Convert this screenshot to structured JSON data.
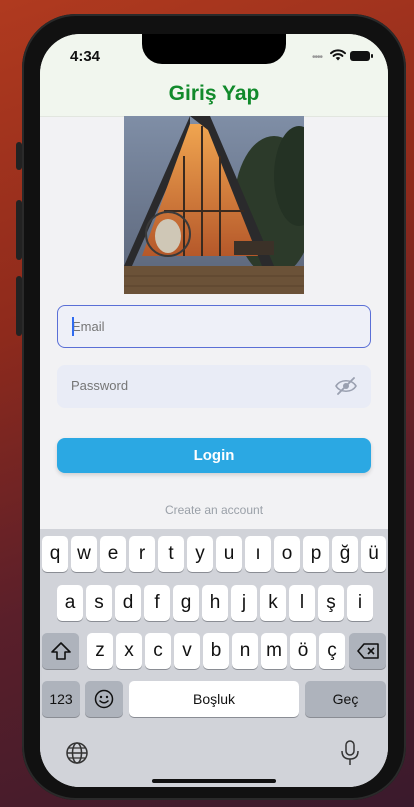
{
  "status": {
    "time": "4:34"
  },
  "nav": {
    "title": "Giriş Yap"
  },
  "form": {
    "email_placeholder": "Email",
    "password_placeholder": "Password",
    "login_label": "Login",
    "create_account_label": "Create an account"
  },
  "keyboard": {
    "row1": [
      "q",
      "w",
      "e",
      "r",
      "t",
      "y",
      "u",
      "ı",
      "o",
      "p",
      "ğ",
      "ü"
    ],
    "row2": [
      "a",
      "s",
      "d",
      "f",
      "g",
      "h",
      "j",
      "k",
      "l",
      "ş",
      "i"
    ],
    "row3": [
      "z",
      "x",
      "c",
      "v",
      "b",
      "n",
      "m",
      "ö",
      "ç"
    ],
    "numbers_label": "123",
    "space_label": "Boşluk",
    "return_label": "Geç"
  },
  "colors": {
    "title": "#118a2b",
    "login": "#2ba8e3",
    "accent": "#5a6fd6"
  },
  "icons": [
    "wifi-icon",
    "battery-icon",
    "eye-off-icon",
    "shift-icon",
    "backspace-icon",
    "emoji-icon",
    "globe-icon",
    "mic-icon"
  ]
}
